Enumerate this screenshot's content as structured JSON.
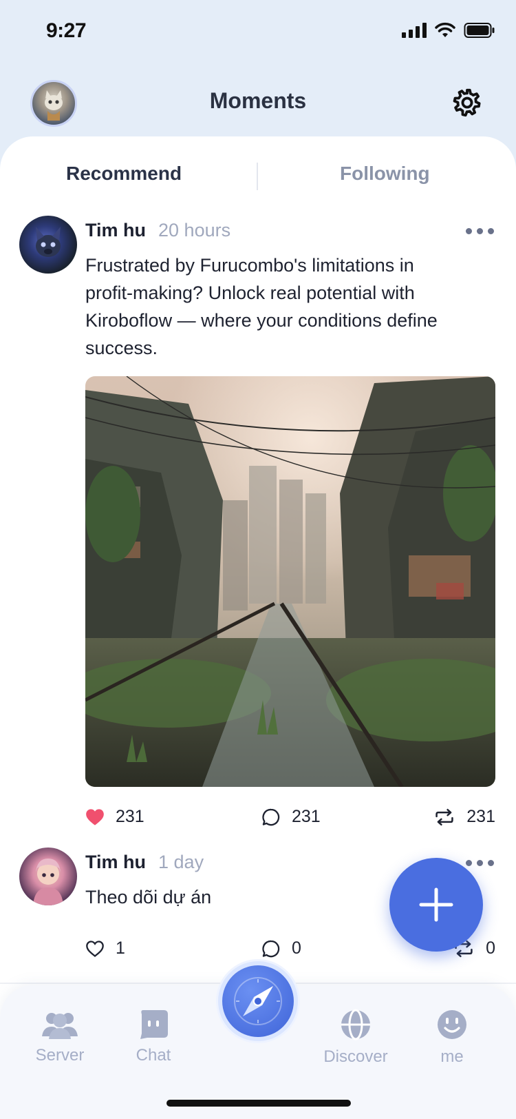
{
  "status_bar": {
    "time": "9:27"
  },
  "header": {
    "title": "Moments"
  },
  "tabs": [
    {
      "label": "Recommend",
      "active": true
    },
    {
      "label": "Following",
      "active": false
    }
  ],
  "posts": [
    {
      "author": "Tim hu",
      "time": "20 hours",
      "text": "Frustrated by Furucombo's limitations in profit-making? Unlock real potential with Kiroboflow — where your conditions define success.",
      "has_image": true,
      "likes": "231",
      "comments": "231",
      "shares": "231",
      "liked": true
    },
    {
      "author": "Tim hu",
      "time": "1 day",
      "text": "Theo dõi dự án",
      "has_image": false,
      "likes": "1",
      "comments": "0",
      "shares": "0",
      "liked": false
    }
  ],
  "bottom_nav": {
    "items": [
      {
        "label": "Server",
        "icon": "users-icon"
      },
      {
        "label": "Chat",
        "icon": "chat-icon"
      },
      {
        "label": "",
        "icon": "compass-icon"
      },
      {
        "label": "Discover",
        "icon": "globe-icon"
      },
      {
        "label": "me",
        "icon": "smile-icon"
      }
    ]
  },
  "colors": {
    "accent": "#4a6ee0",
    "like": "#f0506e",
    "muted": "#a5aec7",
    "background": "#e4edf8"
  }
}
